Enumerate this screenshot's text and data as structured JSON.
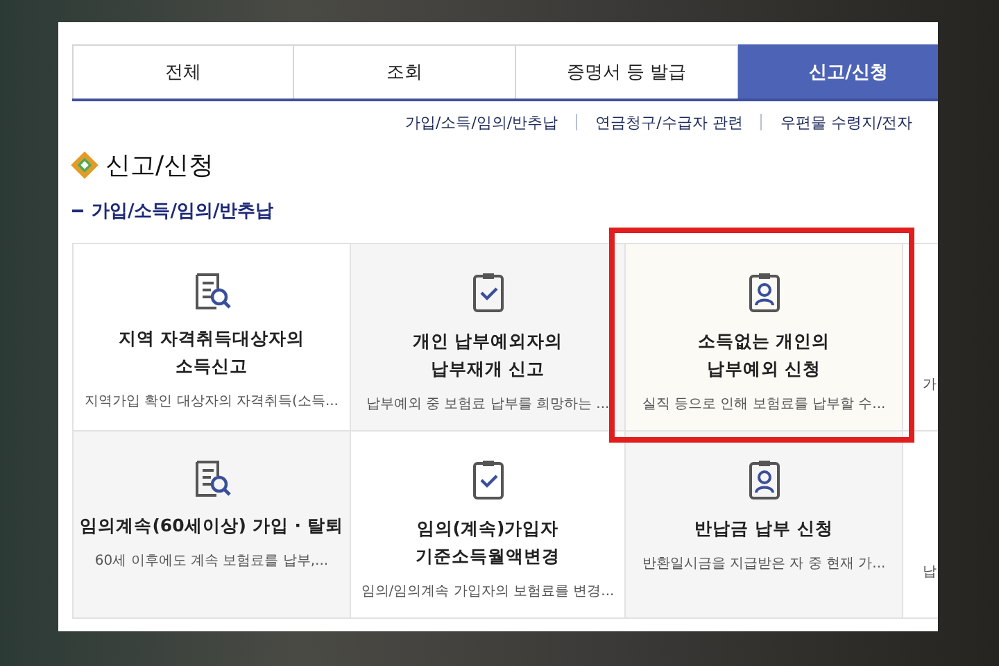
{
  "tabs": [
    {
      "label": "전체",
      "selected": false
    },
    {
      "label": "조회",
      "selected": false
    },
    {
      "label": "증명서 등 발급",
      "selected": false
    },
    {
      "label": "신고/신청",
      "selected": true
    }
  ],
  "sub_links": [
    "가입/소득/임의/반추납",
    "연금청구/수급자 관련",
    "우편물 수령지/전자"
  ],
  "heading": "신고/신청",
  "subheading": "가입/소득/임의/반추납",
  "cards": [
    {
      "kind": "search",
      "title": "지역 자격취득대상자의\n소득신고",
      "description": "지역가입 확인 대상자의 자격취득(소득...",
      "highlighted": false
    },
    {
      "kind": "check",
      "title": "개인 납부예외자의\n납부재개 신고",
      "description": "납부예외 중 보험료 납부를 희망하는 ...",
      "highlighted": false
    },
    {
      "kind": "person",
      "title": "소득없는 개인의\n납부예외 신청",
      "description": "실직 등으로 인해 보험료를 납부할 수...",
      "highlighted": true
    },
    {
      "kind": "partial",
      "description": "가",
      "highlighted": false
    },
    {
      "kind": "search",
      "title": "임의계속(60세이상) 가입 · 탈퇴",
      "description": "60세 이후에도 계속 보험료를 납부,...",
      "highlighted": false
    },
    {
      "kind": "check",
      "title": "임의(계속)가입자\n기준소득월액변경",
      "description": "임의/임의계속 가입자의 보험료를 변경...",
      "highlighted": false
    },
    {
      "kind": "person",
      "title": "반납금 납부 신청",
      "description": "반환일시금을 지급받은 자 중 현재 가...",
      "highlighted": false
    },
    {
      "kind": "partial",
      "description": "납",
      "highlighted": false
    }
  ]
}
